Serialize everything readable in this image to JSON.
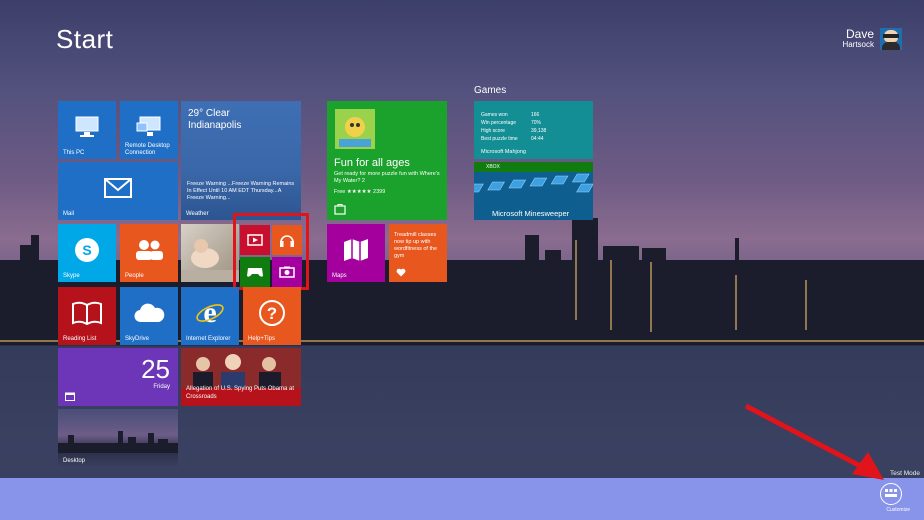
{
  "header": {
    "title": "Start",
    "user_first": "Dave",
    "user_last": "Hartsock"
  },
  "groups": {
    "games": "Games"
  },
  "tiles": {
    "this_pc": "This PC",
    "remote_desktop": "Remote Desktop Connection",
    "mail": "Mail",
    "weather": {
      "temp": "29° Clear",
      "city": "Indianapolis",
      "warning": "Freeze Warning ...Freeze Warning Remains In Effect Until 10 AM EDT Thursday...A Freeze Warning...",
      "label": "Weather"
    },
    "store": {
      "headline": "Fun for all ages",
      "sub": "Get ready for more puzzle fun with Where's My Water? 2",
      "price": "Free ★★★★★ 2399"
    },
    "games_stats": [
      {
        "k": "Games won",
        "v": "166"
      },
      {
        "k": "Win percentage",
        "v": "70%"
      },
      {
        "k": "High score",
        "v": "39,138"
      },
      {
        "k": "Best puzzle time",
        "v": "04:44"
      }
    ],
    "mahjong": "Microsoft Mahjong",
    "minesweeper": {
      "badge": "XBOX",
      "name": "Microsoft Minesweeper"
    },
    "skype": "Skype",
    "people": "People",
    "maps": "Maps",
    "health": "Treadmill classes now tip up with wordfitness of the gym",
    "reading_list": "Reading List",
    "skydrive": "SkyDrive",
    "internet_explorer": "Internet Explorer",
    "help_tips": "Help+Tips",
    "calendar": {
      "num": "25",
      "day": "Friday"
    },
    "news": "Allegation of U.S. Spying Puts Obama at Crossroads",
    "desktop": "Desktop"
  },
  "footer": {
    "test_mode": "Test Mode",
    "customize": "Customize"
  },
  "colors": {
    "blue": "#1f6fc7",
    "orange": "#e8571e",
    "green": "#1aa22c",
    "magenta": "#a3009e",
    "teal": "#138e94",
    "red": "#b5121b",
    "purple": "#6d35b7",
    "charms": "#8893ea",
    "highlight": "#e0141a"
  }
}
